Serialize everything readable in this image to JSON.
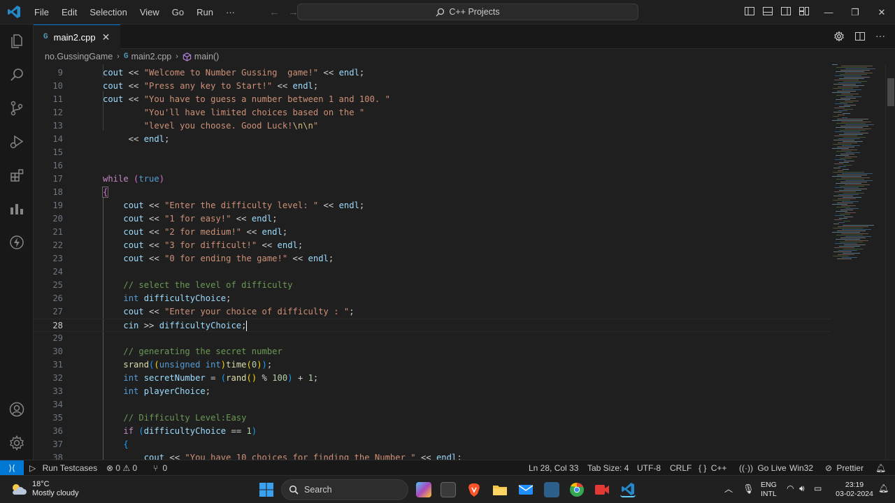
{
  "titlebar": {
    "menu": [
      "File",
      "Edit",
      "Selection",
      "View",
      "Go",
      "Run",
      "···"
    ],
    "search": "C++ Projects"
  },
  "tab": {
    "label": "main2.cpp",
    "close": "✕"
  },
  "breadcrumb": {
    "folder": "no.GussingGame",
    "file": "main2.cpp",
    "symbol": "main()"
  },
  "editor": {
    "current_line": 28,
    "lines": [
      {
        "n": "9",
        "html": "<span class=\"var\">cout</span> << <span class=\"str\">\"Welcome to Number Gussing  game!\"</span> << <span class=\"var\">endl</span>;"
      },
      {
        "n": "10",
        "html": "<span class=\"var\">cout</span> << <span class=\"str\">\"Press any key to Start!\"</span> << <span class=\"var\">endl</span>;"
      },
      {
        "n": "11",
        "html": "<span class=\"var\">cout</span> << <span class=\"str\">\"You have to guess a number between 1 and 100. \"</span>"
      },
      {
        "n": "12",
        "html": "        <span class=\"str\">\"You'll have limited choices based on the \"</span>"
      },
      {
        "n": "13",
        "html": "        <span class=\"str\">\"level you choose. Good Luck!<span class=\"esc\">\\n\\n</span>\"</span>"
      },
      {
        "n": "14",
        "html": "     << <span class=\"var\">endl</span>;"
      },
      {
        "n": "15",
        "html": ""
      },
      {
        "n": "16",
        "html": ""
      },
      {
        "n": "17",
        "html": "<span class=\"ctl\">while</span> <span class=\"br2\">(</span><span class=\"kw\">true</span><span class=\"br2\">)</span>"
      },
      {
        "n": "18",
        "html": "<span class=\"br2 bracket-box\">{</span>"
      },
      {
        "n": "19",
        "html": "    <span class=\"var\">cout</span> << <span class=\"str\">\"Enter the difficulty level: \"</span> << <span class=\"var\">endl</span>;"
      },
      {
        "n": "20",
        "html": "    <span class=\"var\">cout</span> << <span class=\"str\">\"1 for easy!\"</span> << <span class=\"var\">endl</span>;"
      },
      {
        "n": "21",
        "html": "    <span class=\"var\">cout</span> << <span class=\"str\">\"2 for medium!\"</span> << <span class=\"var\">endl</span>;"
      },
      {
        "n": "22",
        "html": "    <span class=\"var\">cout</span> << <span class=\"str\">\"3 for difficult!\"</span> << <span class=\"var\">endl</span>;"
      },
      {
        "n": "23",
        "html": "    <span class=\"var\">cout</span> << <span class=\"str\">\"0 for ending the game!\"</span> << <span class=\"var\">endl</span>;"
      },
      {
        "n": "24",
        "html": ""
      },
      {
        "n": "25",
        "html": "    <span class=\"cm\">// select the level of difficulty</span>"
      },
      {
        "n": "26",
        "html": "    <span class=\"kw\">int</span> <span class=\"var\">difficultyChoice</span>;"
      },
      {
        "n": "27",
        "html": "    <span class=\"var\">cout</span> << <span class=\"str\">\"Enter your choice of difficulty : \"</span>;"
      },
      {
        "n": "28",
        "html": "    <span class=\"var\">cin</span> >> <span class=\"var\">difficultyChoice</span>;<span class=\"cursor\"></span>"
      },
      {
        "n": "29",
        "html": ""
      },
      {
        "n": "30",
        "html": "    <span class=\"cm\">// generating the secret number</span>"
      },
      {
        "n": "31",
        "html": "    <span class=\"fn\">srand</span><span class=\"br3\">(</span><span class=\"br1\">(</span><span class=\"kw\">unsigned</span> <span class=\"kw\">int</span><span class=\"br1\">)</span><span class=\"fn\">time</span><span class=\"br1\">(</span><span class=\"num\">0</span><span class=\"br1\">)</span><span class=\"br3\">)</span>;"
      },
      {
        "n": "32",
        "html": "    <span class=\"kw\">int</span> <span class=\"var\">secretNumber</span> = <span class=\"br3\">(</span><span class=\"fn\">rand</span><span class=\"br1\">()</span> % <span class=\"num\">100</span><span class=\"br3\">)</span> + <span class=\"num\">1</span>;"
      },
      {
        "n": "33",
        "html": "    <span class=\"kw\">int</span> <span class=\"var\">playerChoice</span>;"
      },
      {
        "n": "34",
        "html": ""
      },
      {
        "n": "35",
        "html": "    <span class=\"cm\">// Difficulty Level:Easy</span>"
      },
      {
        "n": "36",
        "html": "    <span class=\"ctl\">if</span> <span class=\"br3\">(</span><span class=\"var\">difficultyChoice</span> == <span class=\"num\">1</span><span class=\"br3\">)</span>"
      },
      {
        "n": "37",
        "html": "    <span class=\"br3\">{</span>"
      },
      {
        "n": "38",
        "html": "        <span class=\"var\">cout</span> << <span class=\"str\">\"You have 10 choices for finding the Number \"</span> << <span class=\"var\">endl</span>;"
      }
    ]
  },
  "statusbar": {
    "run_testcases": "Run Testcases",
    "problems": "⊗ 0 ⚠ 0",
    "ports": "0",
    "position": "Ln 28, Col 33",
    "tab_size": "Tab Size: 4",
    "encoding": "UTF-8",
    "eol": "CRLF",
    "language": "C++",
    "go_live": "Go Live",
    "platform": "Win32",
    "prettier": "Prettier"
  },
  "taskbar": {
    "temperature": "18°C",
    "weather": "Mostly cloudy",
    "search": "Search",
    "lang1": "ENG",
    "lang2": "INTL",
    "time": "23:19",
    "date": "03-02-2024"
  },
  "colors": {
    "accent": "#0078d4",
    "string": "#ce9178",
    "keyword": "#569cd6",
    "comment": "#6a9955"
  }
}
